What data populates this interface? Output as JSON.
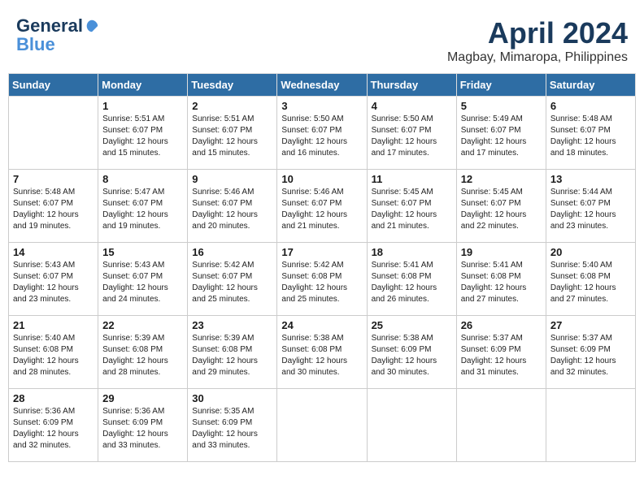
{
  "header": {
    "logo_line1": "General",
    "logo_line2": "Blue",
    "month": "April 2024",
    "location": "Magbay, Mimaropa, Philippines"
  },
  "days_of_week": [
    "Sunday",
    "Monday",
    "Tuesday",
    "Wednesday",
    "Thursday",
    "Friday",
    "Saturday"
  ],
  "weeks": [
    [
      {
        "day": "",
        "info": ""
      },
      {
        "day": "1",
        "info": "Sunrise: 5:51 AM\nSunset: 6:07 PM\nDaylight: 12 hours\nand 15 minutes."
      },
      {
        "day": "2",
        "info": "Sunrise: 5:51 AM\nSunset: 6:07 PM\nDaylight: 12 hours\nand 15 minutes."
      },
      {
        "day": "3",
        "info": "Sunrise: 5:50 AM\nSunset: 6:07 PM\nDaylight: 12 hours\nand 16 minutes."
      },
      {
        "day": "4",
        "info": "Sunrise: 5:50 AM\nSunset: 6:07 PM\nDaylight: 12 hours\nand 17 minutes."
      },
      {
        "day": "5",
        "info": "Sunrise: 5:49 AM\nSunset: 6:07 PM\nDaylight: 12 hours\nand 17 minutes."
      },
      {
        "day": "6",
        "info": "Sunrise: 5:48 AM\nSunset: 6:07 PM\nDaylight: 12 hours\nand 18 minutes."
      }
    ],
    [
      {
        "day": "7",
        "info": "Sunrise: 5:48 AM\nSunset: 6:07 PM\nDaylight: 12 hours\nand 19 minutes."
      },
      {
        "day": "8",
        "info": "Sunrise: 5:47 AM\nSunset: 6:07 PM\nDaylight: 12 hours\nand 19 minutes."
      },
      {
        "day": "9",
        "info": "Sunrise: 5:46 AM\nSunset: 6:07 PM\nDaylight: 12 hours\nand 20 minutes."
      },
      {
        "day": "10",
        "info": "Sunrise: 5:46 AM\nSunset: 6:07 PM\nDaylight: 12 hours\nand 21 minutes."
      },
      {
        "day": "11",
        "info": "Sunrise: 5:45 AM\nSunset: 6:07 PM\nDaylight: 12 hours\nand 21 minutes."
      },
      {
        "day": "12",
        "info": "Sunrise: 5:45 AM\nSunset: 6:07 PM\nDaylight: 12 hours\nand 22 minutes."
      },
      {
        "day": "13",
        "info": "Sunrise: 5:44 AM\nSunset: 6:07 PM\nDaylight: 12 hours\nand 23 minutes."
      }
    ],
    [
      {
        "day": "14",
        "info": "Sunrise: 5:43 AM\nSunset: 6:07 PM\nDaylight: 12 hours\nand 23 minutes."
      },
      {
        "day": "15",
        "info": "Sunrise: 5:43 AM\nSunset: 6:07 PM\nDaylight: 12 hours\nand 24 minutes."
      },
      {
        "day": "16",
        "info": "Sunrise: 5:42 AM\nSunset: 6:07 PM\nDaylight: 12 hours\nand 25 minutes."
      },
      {
        "day": "17",
        "info": "Sunrise: 5:42 AM\nSunset: 6:08 PM\nDaylight: 12 hours\nand 25 minutes."
      },
      {
        "day": "18",
        "info": "Sunrise: 5:41 AM\nSunset: 6:08 PM\nDaylight: 12 hours\nand 26 minutes."
      },
      {
        "day": "19",
        "info": "Sunrise: 5:41 AM\nSunset: 6:08 PM\nDaylight: 12 hours\nand 27 minutes."
      },
      {
        "day": "20",
        "info": "Sunrise: 5:40 AM\nSunset: 6:08 PM\nDaylight: 12 hours\nand 27 minutes."
      }
    ],
    [
      {
        "day": "21",
        "info": "Sunrise: 5:40 AM\nSunset: 6:08 PM\nDaylight: 12 hours\nand 28 minutes."
      },
      {
        "day": "22",
        "info": "Sunrise: 5:39 AM\nSunset: 6:08 PM\nDaylight: 12 hours\nand 28 minutes."
      },
      {
        "day": "23",
        "info": "Sunrise: 5:39 AM\nSunset: 6:08 PM\nDaylight: 12 hours\nand 29 minutes."
      },
      {
        "day": "24",
        "info": "Sunrise: 5:38 AM\nSunset: 6:08 PM\nDaylight: 12 hours\nand 30 minutes."
      },
      {
        "day": "25",
        "info": "Sunrise: 5:38 AM\nSunset: 6:09 PM\nDaylight: 12 hours\nand 30 minutes."
      },
      {
        "day": "26",
        "info": "Sunrise: 5:37 AM\nSunset: 6:09 PM\nDaylight: 12 hours\nand 31 minutes."
      },
      {
        "day": "27",
        "info": "Sunrise: 5:37 AM\nSunset: 6:09 PM\nDaylight: 12 hours\nand 32 minutes."
      }
    ],
    [
      {
        "day": "28",
        "info": "Sunrise: 5:36 AM\nSunset: 6:09 PM\nDaylight: 12 hours\nand 32 minutes."
      },
      {
        "day": "29",
        "info": "Sunrise: 5:36 AM\nSunset: 6:09 PM\nDaylight: 12 hours\nand 33 minutes."
      },
      {
        "day": "30",
        "info": "Sunrise: 5:35 AM\nSunset: 6:09 PM\nDaylight: 12 hours\nand 33 minutes."
      },
      {
        "day": "",
        "info": ""
      },
      {
        "day": "",
        "info": ""
      },
      {
        "day": "",
        "info": ""
      },
      {
        "day": "",
        "info": ""
      }
    ]
  ]
}
